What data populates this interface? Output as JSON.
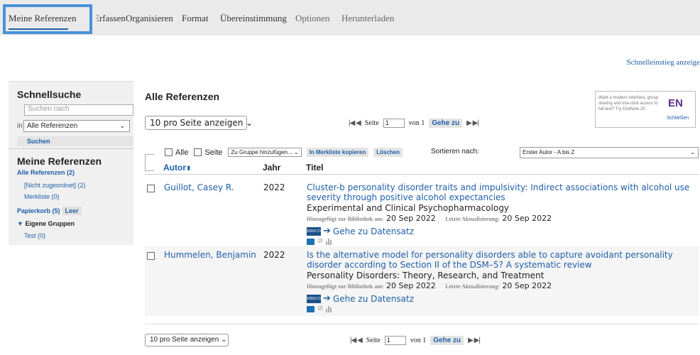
{
  "nav": {
    "items": [
      "Meine Referenzen",
      "Erfassen",
      "Organisieren",
      "Format",
      "Übereinstimmung",
      "Optionen",
      "Herunterladen"
    ]
  },
  "quickstart_link": "Schnelleinstieg anzeige",
  "sidebar": {
    "search_title": "Schnellsuche",
    "search_placeholder": "Suchen nach",
    "in_label": "in",
    "scope_value": "Alle Referenzen",
    "search_button": "Suchen",
    "refs_title": "Meine Referenzen",
    "all_refs": "Alle Referenzen (2)",
    "unassigned": "[Nicht zugeordnet] (2)",
    "quicklist": "Merkliste (0)",
    "trash": "Papierkorb (5)",
    "trash_empty": "Leer",
    "groups_title": "Eigene Gruppen",
    "group_test": "Test (0)"
  },
  "main": {
    "title": "Alle Referenzen",
    "per_page": "10 pro Seite anzeigen",
    "page_label": "Seite",
    "page_value": "1",
    "of_label": "von 1",
    "goto": "Gehe zu"
  },
  "promo": {
    "text": "Want a modern interface, group sharing and one-click access to full text? Try EndNote 20.",
    "badge": "EN",
    "close": "Schließen"
  },
  "toolbar": {
    "all": "Alle",
    "page": "Seite",
    "add_group": "Zu Gruppe hinzufügen...",
    "copy_quicklist": "In Merkliste kopieren",
    "delete": "Löschen",
    "sort_label": "Sortieren nach:",
    "sort_value": "Erster Autor - A bis Z"
  },
  "columns": {
    "author": "Autor",
    "year": "Jahr",
    "title": "Titel"
  },
  "references": [
    {
      "author": "Guillot, Casey R.",
      "year": "2022",
      "title": "Cluster-b personality disorder traits and impulsivity: Indirect associations with alcohol use severity through positive alcohol expectancies",
      "journal": "Experimental and Clinical Psychopharmacology",
      "added_label": "Hinzugefügt zur Bibliothek am:",
      "added_date": "20 Sep 2022",
      "updated_label": "Letzte Aktualisierung:",
      "updated_date": "20 Sep 2022",
      "source_link": "Gehe zu Datensatz",
      "source_logo": "EBSCO"
    },
    {
      "author": "Hummelen, Benjamin",
      "year": "2022",
      "title": "Is the alternative model for personality disorders able to capture avoidant personality disorder according to Section II of the DSM–5? A systematic review",
      "journal": "Personality Disorders: Theory, Research, and Treatment",
      "added_label": "Hinzugefügt zur Bibliothek am:",
      "added_date": "20 Sep 2022",
      "updated_label": "Letzte Aktualisierung:",
      "updated_date": "20 Sep 2022",
      "source_link": "Gehe zu Datensatz",
      "source_logo": "EBSCO"
    }
  ],
  "colors": {
    "link": "#1f5fa8",
    "nav_highlight": "#4a90d9",
    "badge": "#5c2d91"
  }
}
